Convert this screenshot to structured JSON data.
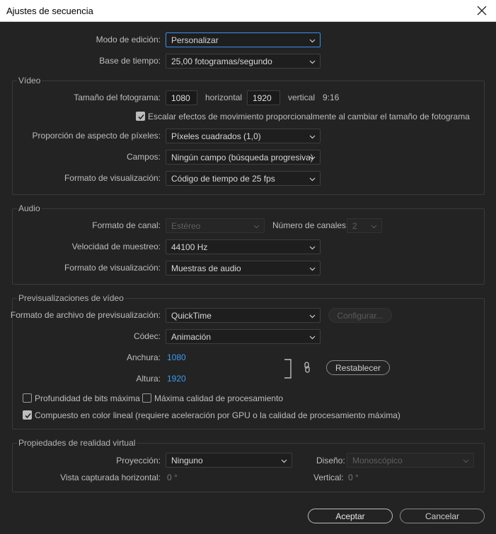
{
  "window": {
    "title": "Ajustes de secuencia"
  },
  "general": {
    "edit_mode_label": "Modo de edición:",
    "edit_mode_value": "Personalizar",
    "timebase_label": "Base de tiempo:",
    "timebase_value": "25,00  fotogramas/segundo"
  },
  "video": {
    "group_title": "Vídeo",
    "frame_size_label": "Tamaño del fotograma:",
    "width_value": "1080",
    "horizontal_label": "horizontal",
    "height_value": "1920",
    "vertical_label": "vertical",
    "aspect_label": "9:16",
    "scale_checkbox_label": "Escalar efectos de movimiento proporcionalmente al cambiar el tamaño de fotograma",
    "pixel_aspect_label": "Proporción de aspecto de píxeles:",
    "pixel_aspect_value": "Píxeles cuadrados (1,0)",
    "fields_label": "Campos:",
    "fields_value": "Ningún campo (búsqueda progresiva)",
    "display_format_label": "Formato de visualización:",
    "display_format_value": "Código de tiempo de 25 fps"
  },
  "audio": {
    "group_title": "Audio",
    "channel_format_label": "Formato de canal:",
    "channel_format_value": "Estéreo",
    "channels_count_label": "Número de canales:",
    "channels_count_value": "2",
    "sample_rate_label": "Velocidad de muestreo:",
    "sample_rate_value": "44100 Hz",
    "display_format_label": "Formato de visualización:",
    "display_format_value": "Muestras de audio"
  },
  "previews": {
    "group_title": "Previsualizaciones de vídeo",
    "file_format_label": "Formato de archivo de previsualización:",
    "file_format_value": "QuickTime",
    "configure_label": "Configurar...",
    "codec_label": "Códec:",
    "codec_value": "Animación",
    "width_label": "Anchura:",
    "width_value": "1080",
    "height_label": "Altura:",
    "height_value": "1920",
    "reset_label": "Restablecer",
    "max_bit_depth_label": "Profundidad de bits máxima",
    "max_quality_label": "Máxima calidad de procesamiento",
    "linear_color_label": "Compuesto en color lineal (requiere aceleración por GPU o la calidad de procesamiento máxima)"
  },
  "vr": {
    "group_title": "Propiedades de realidad virtual",
    "projection_label": "Proyección:",
    "projection_value": "Ninguno",
    "layout_label": "Diseño:",
    "layout_value": "Monoscópico",
    "h_view_label": "Vista capturada horizontal:",
    "h_view_value": "0 °",
    "vertical_label": "Vertical:",
    "vertical_value": "0 °"
  },
  "footer": {
    "accept_label": "Aceptar",
    "cancel_label": "Cancelar"
  }
}
